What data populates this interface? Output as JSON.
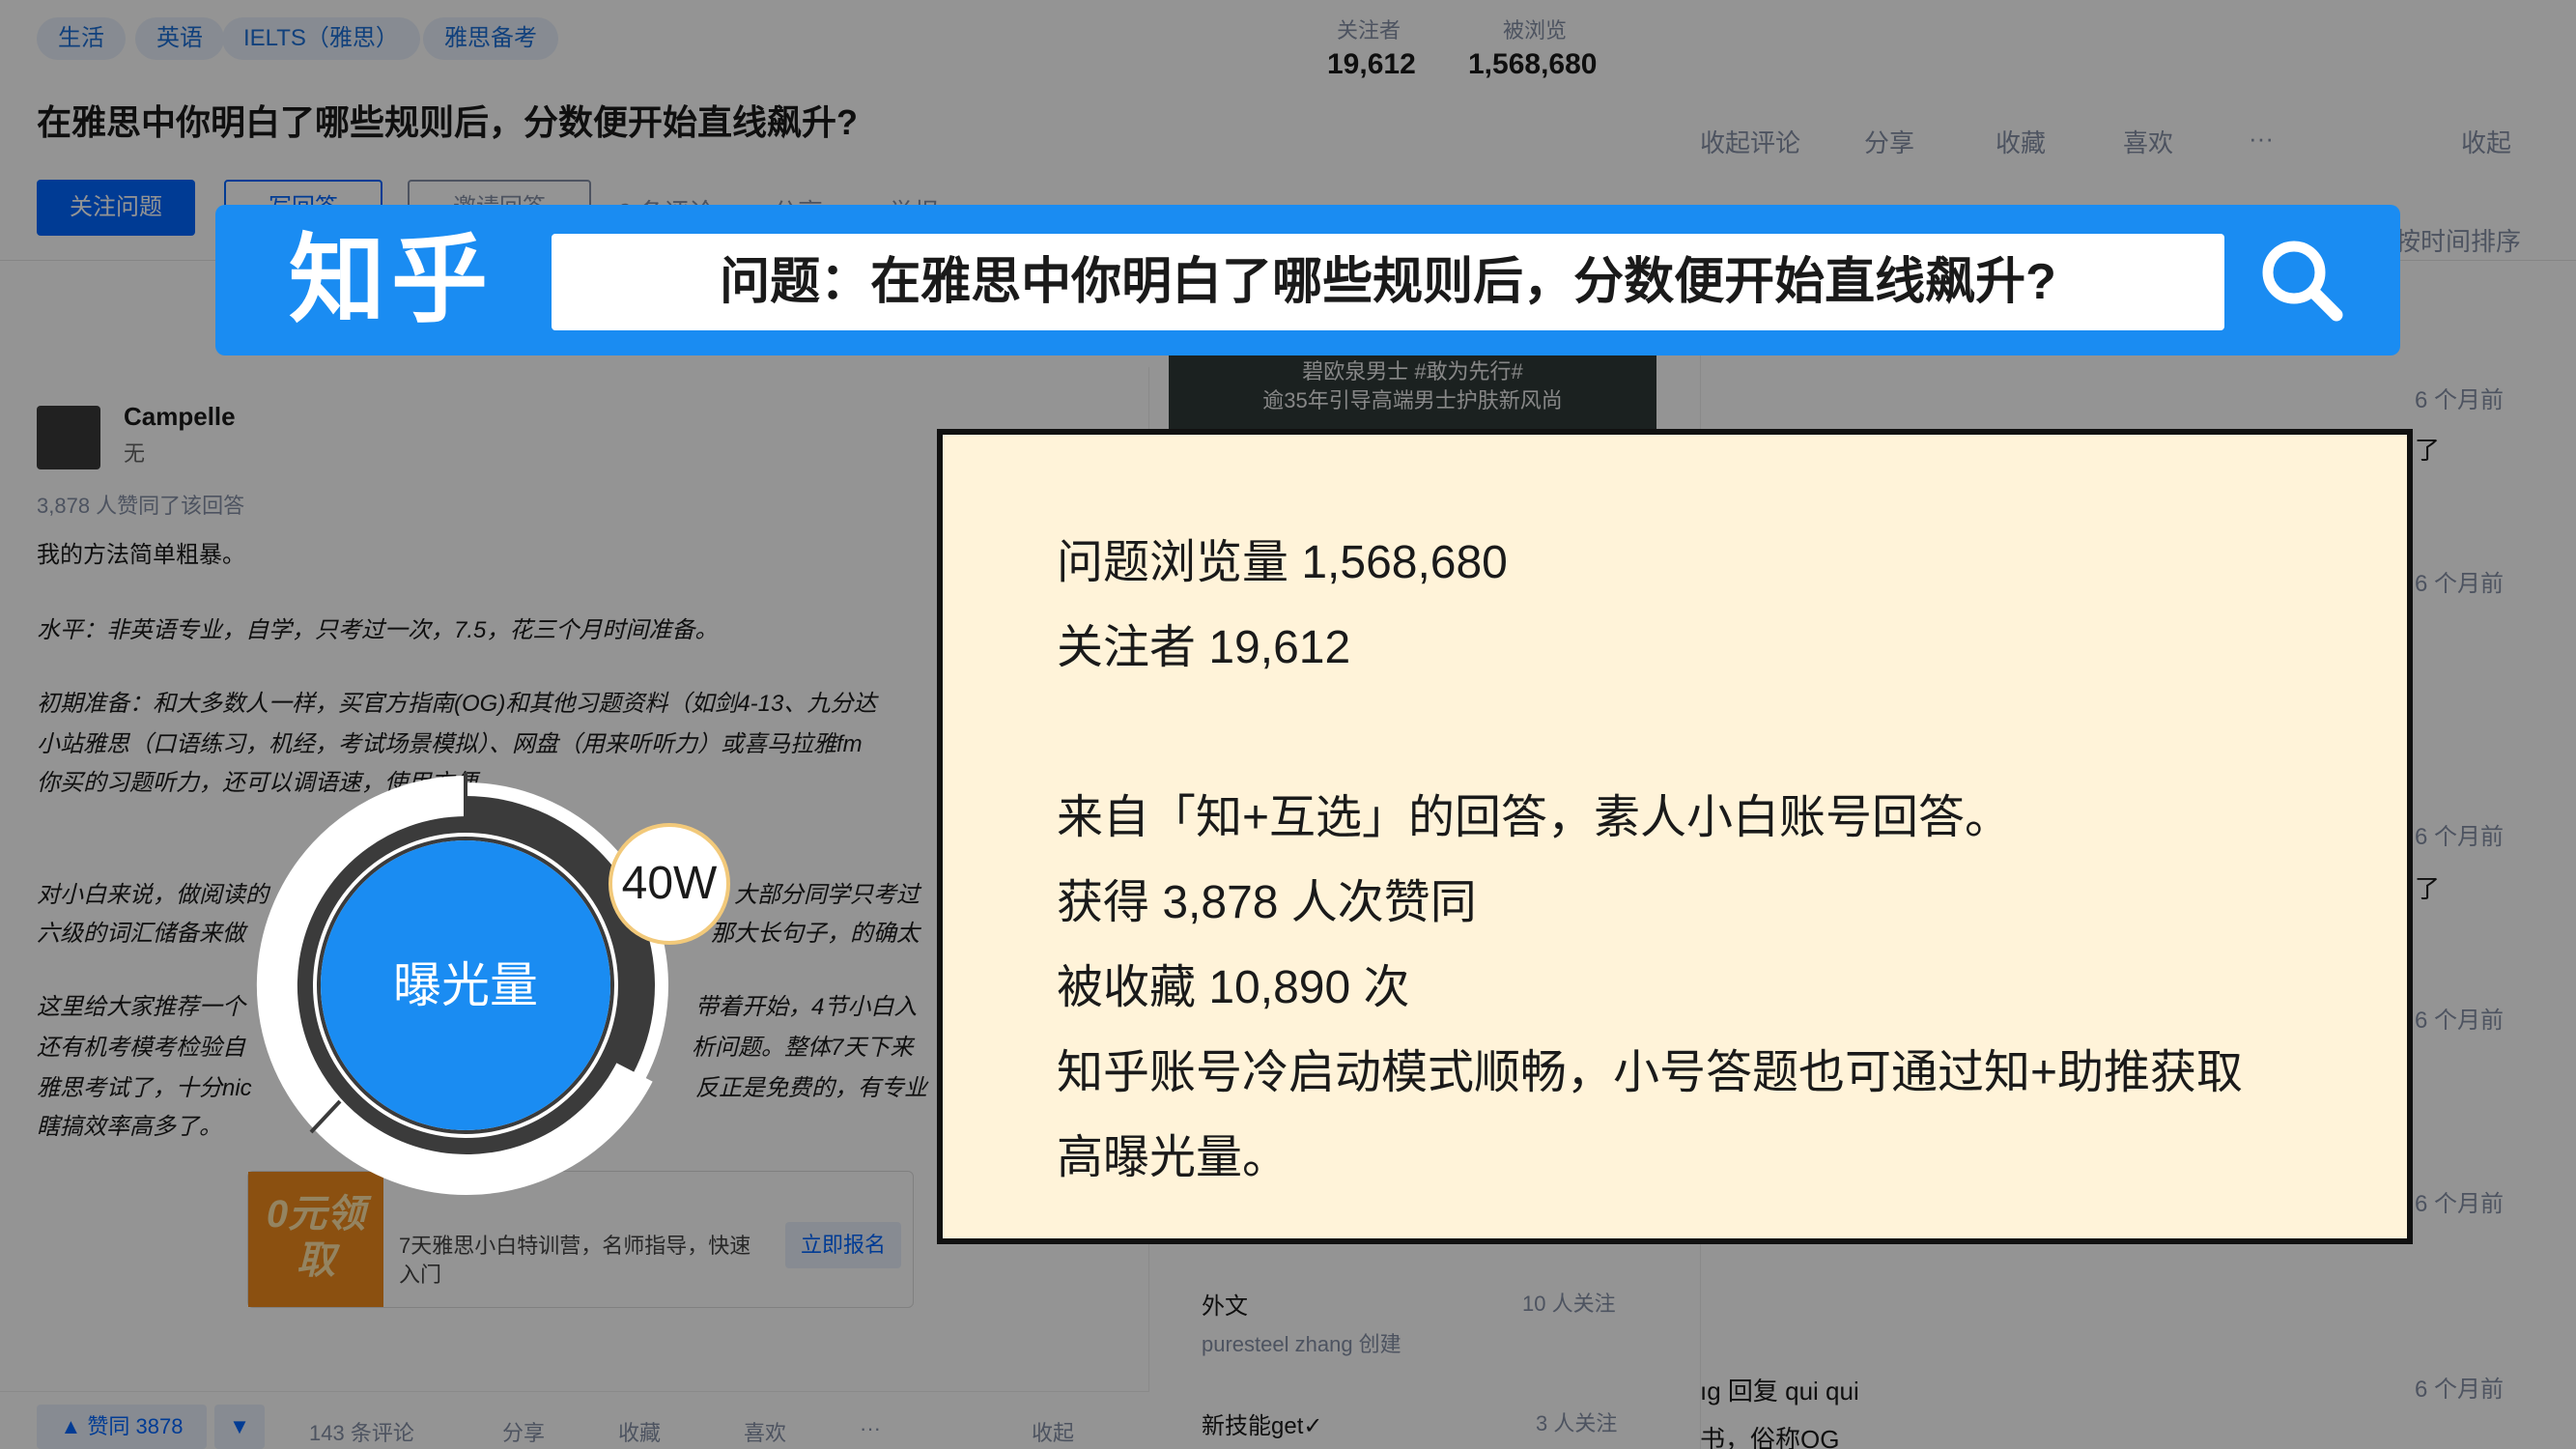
{
  "background": {
    "tags": [
      "生活",
      "英语",
      "IELTS（雅思）",
      "雅思备考"
    ],
    "question_title": "在雅思中你明白了哪些规则后，分数便开始直线飙升?",
    "stats": {
      "followers_label": "关注者",
      "followers_value": "19,612",
      "views_label": "被浏览",
      "views_value": "1,568,680"
    },
    "buttons": {
      "follow": "关注问题",
      "write": "写回答",
      "invite": "邀请回答",
      "comments": "9 条评论",
      "share": "分享",
      "report": "举报"
    },
    "right_actions": [
      "收起评论",
      "分享",
      "收藏",
      "喜欢",
      "···",
      "收起"
    ],
    "sort_label": "按时间排序",
    "answer": {
      "author": "Campelle",
      "bio": "无",
      "upvotes_line": "3,878 人赞同了该回答",
      "lines": [
        "我的方法简单粗暴。",
        "水平：非英语专业，自学，只考过一次，7.5，花三个月时间准备。",
        "初期准备：和大多数人一样，买官方指南(OG)和其他习题资料（如剑4-13、九分达",
        "小站雅思（口语练习，机经，考试场景模拟）、网盘（用来听听力）或喜马拉雅fm",
        "你买的习题听力，还可以调语速，使用方便",
        "对小白来说，做阅读的",
        "六级的词汇储备来做",
        "这里给大家推荐一个",
        "还有机考模考检验自",
        "雅思考试了，十分nic",
        "瞎搞效率高多了。"
      ],
      "lines_right": [
        "大部分同学只考过",
        "那大长句子，的确太",
        "带着开始，4节小白入",
        "析问题。整体7天下来",
        "反正是免费的，有专业"
      ]
    },
    "promo": {
      "badge": "0元领取",
      "text": "7天雅思小白特训营，名师指导，快速入门",
      "button": "立即报名"
    },
    "bottom_bar": {
      "vote": "▲ 赞同 3878",
      "down": "▼",
      "comments": "143 条评论",
      "share": "分享",
      "collect": "收藏",
      "like": "喜欢",
      "more": "···",
      "collapse": "收起"
    },
    "side_ad": [
      "碧欧泉男士 #敢为先行#",
      "逾35年引导高端男士护肤新风尚"
    ],
    "side_list": [
      {
        "name": "外文",
        "meta": "10 人关注",
        "sub": "puresteel zhang 创建"
      },
      {
        "name": "新技能get✓",
        "meta": "3 人关注",
        "sub": ""
      }
    ],
    "right_comments": {
      "time": "6 个月前",
      "snippets": [
        "了",
        "了"
      ],
      "bottom": [
        "ıg 回复 qui qui",
        "书，俗称OG"
      ]
    }
  },
  "banner": {
    "logo": "知乎",
    "query": "问题：在雅思中你明白了哪些规则后，分数便开始直线飙升?",
    "bg_color": "#1a8cf2"
  },
  "info_card": {
    "lines": [
      "问题浏览量  1,568,680",
      "关注者  19,612",
      "来自「知+互选」的回答，素人小白账号回答。",
      "获得 3,878 人次赞同",
      "被收藏 10,890 次",
      "知乎账号冷启动模式顺畅，小号答题也可通过知+助推获取",
      "高曝光量。"
    ],
    "bg_color": "#fff3d9"
  },
  "ring": {
    "center_label": "曝光量",
    "bubble_label": "40W",
    "center_color": "#1a8cf2"
  }
}
